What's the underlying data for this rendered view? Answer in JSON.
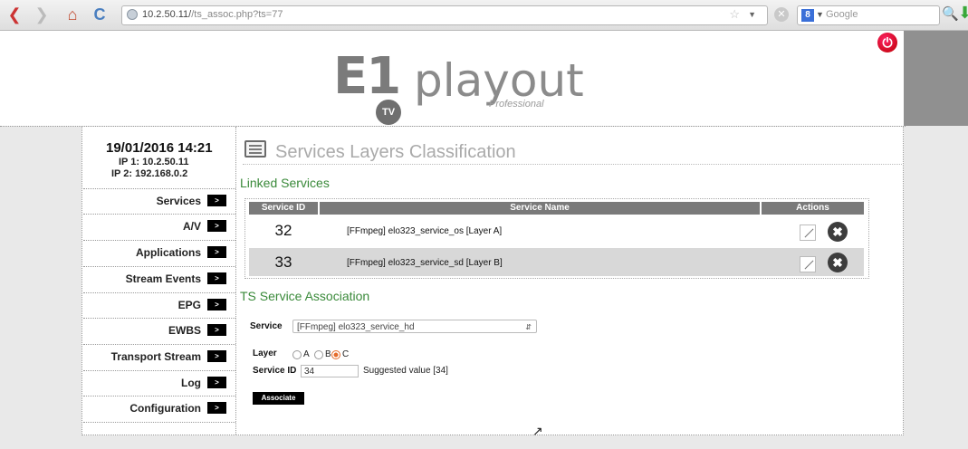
{
  "browser": {
    "url_host": "10.2.50.11/",
    "url_path": "/ts_assoc.php?ts=77",
    "search_placeholder": "Google",
    "search_engine_letter": "8"
  },
  "brand": {
    "logo_main": "E1",
    "logo_badge": "TV",
    "logo_word": "playout",
    "logo_sub": "Professional"
  },
  "sidebar": {
    "datetime": "19/01/2016 14:21",
    "ip1": "IP 1: 10.2.50.11",
    "ip2": "IP 2: 192.168.0.2",
    "arrow": ">",
    "items": [
      {
        "label": "Services"
      },
      {
        "label": "A/V"
      },
      {
        "label": "Applications"
      },
      {
        "label": "Stream Events"
      },
      {
        "label": "EPG"
      },
      {
        "label": "EWBS"
      },
      {
        "label": "Transport Stream"
      },
      {
        "label": "Log"
      },
      {
        "label": "Configuration"
      }
    ]
  },
  "main": {
    "page_title": "Services Layers Classification",
    "linked_title": "Linked Services",
    "table": {
      "headers": [
        "Service ID",
        "Service Name",
        "Actions"
      ],
      "rows": [
        {
          "id": "32",
          "name": "[FFmpeg] elo323_service_os [Layer A]"
        },
        {
          "id": "33",
          "name": "[FFmpeg] elo323_service_sd [Layer B]"
        }
      ]
    },
    "assoc_title": "TS Service Association",
    "form": {
      "service_label": "Service",
      "service_value": "[FFmpeg] elo323_service_hd",
      "layer_label": "Layer",
      "layer_options": [
        "A",
        "B",
        "C"
      ],
      "layer_selected": "C",
      "id_label": "Service ID",
      "id_value": "34",
      "suggested": "Suggested value [34]",
      "button": "Associate"
    }
  }
}
